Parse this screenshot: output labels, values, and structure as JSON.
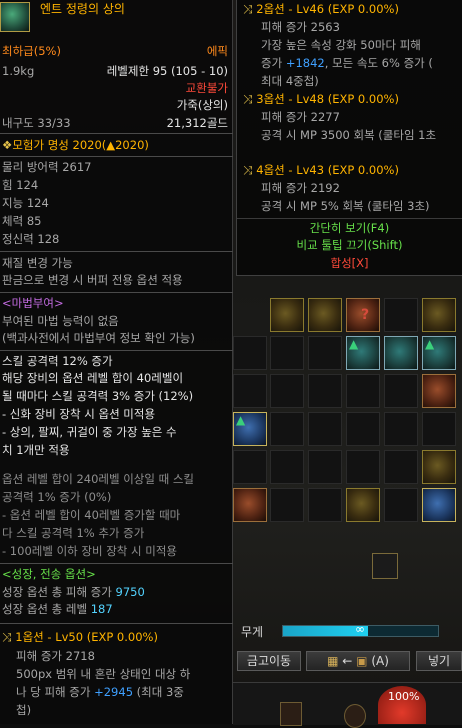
{
  "item": {
    "name": "엔트 정령의 상의",
    "rarity_pct": "최하급(5%)",
    "rarity": "에픽",
    "weight": "1.9kg",
    "level_limit": "레벨제한 95 (105 - 10)",
    "trade": "교환불가",
    "type": "가죽(상의)",
    "durability": "내구도 33/33",
    "price": "21,312골드",
    "fame": "모험가 명성 2020(▲2020)",
    "stats": [
      "물리 방어력 2617",
      "힘 124",
      "지능 124",
      "체력 85",
      "정신력 128"
    ],
    "reforge": [
      "재질 변경 가능",
      "판금으로 변경 시 버퍼 전용 옵션 적용"
    ],
    "magic_header": "<마법부여>",
    "magic_lines": [
      "부여된 마법 능력이 없음",
      "(백과사전에서 마법부여 정보 확인 가능)"
    ],
    "effect_lines": [
      "스킬 공격력 12% 증가",
      "해당 장비의 옵션 레벨 합이 40레벨이",
      "될 때마다 스킬 공격력 3% 증가 (12%)",
      "- 신화 장비 장착 시 옵션 미적용",
      "- 상의, 팔찌, 귀걸이 중 가장 높은 수",
      "치 1개만 적용"
    ],
    "effect2_lines": [
      "옵션 레벨 합이 240레벨 이상일 때 스킬",
      "공격력 1% 증가 (0%)",
      "- 옵션 레벨 합이 40레벨 증가할 때마",
      "다 스킬 공격력 1% 추가 증가",
      "- 100레벨 이하 장비 장착 시 미적용"
    ],
    "growth_header": "<성장, 전송 옵션>",
    "growth_damage_label": "성장 옵션 총 피해 증가",
    "growth_damage_value": "9750",
    "growth_level_label": "성장 옵션 총 레벨",
    "growth_level_value": "187",
    "option1": {
      "title": "1옵션 - Lv50 (EXP 0.00%)",
      "damage": "피해 증가 2718",
      "desc1": "500px 범위 내 혼란 상태인 대상 하",
      "desc2_a": "나 당 피해 증가 ",
      "desc2_b": "+2945",
      "desc2_c": " (최대 3중",
      "desc3": "첩)"
    }
  },
  "right_tooltip": {
    "option2": {
      "title": "2옵션 - Lv46 (EXP 0.00%)",
      "damage": "피해 증가 2563",
      "desc1": "가장 높은 속성 강화 50마다 피해",
      "desc2_a": "증가 ",
      "desc2_b": "+1842",
      "desc2_c": ", 모든 속도 6% 증가 (",
      "desc3": "최대 4중첩)"
    },
    "option3": {
      "title": "3옵션 - Lv48 (EXP 0.00%)",
      "damage": "피해 증가 2277",
      "desc1": "공격 시 MP 3500 회복 (쿨타임 1초"
    },
    "option4": {
      "title": "4옵션 - Lv43 (EXP 0.00%)",
      "damage": "피해 증가 2192",
      "desc1": "공격 시 MP 5% 회복 (쿨타임 3초)"
    },
    "simple_view": "간단히 보기(F4)",
    "compare_off": "비교 툴팁 끄기(Shift)",
    "compose": "합성[X]"
  },
  "inventory": {
    "weight_label": "무게",
    "weight_fill": 0.55,
    "weight_value": "∞",
    "vault_button": "금고이동",
    "auto_move_button": "←",
    "auto_key": "(A)",
    "sell_button": "넣기",
    "hp_percent": "100%"
  },
  "colors": {
    "gold": "#ffb400",
    "epic": "#ff8a1c",
    "untradeable": "#ff4a3a",
    "blue_value": "#3fa0ff",
    "green": "#67e04a"
  },
  "icons": [
    "hexagon-option-icon",
    "fame-icon",
    "inventory-item-icons",
    "hp-orb"
  ]
}
